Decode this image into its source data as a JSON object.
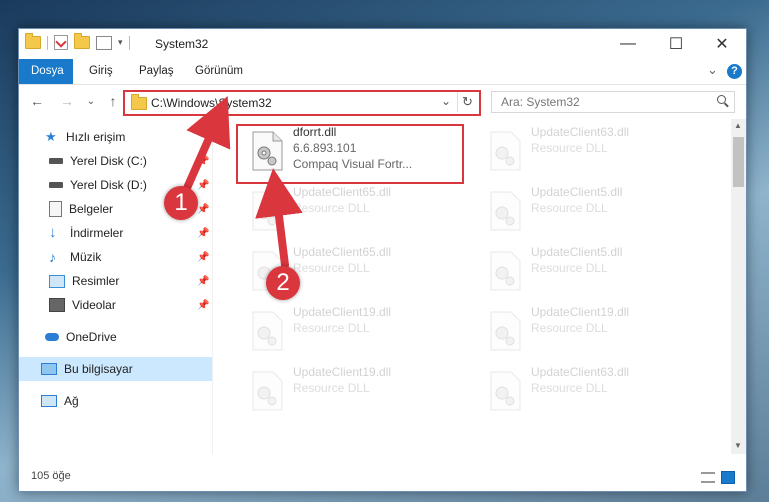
{
  "window": {
    "title": "System32",
    "controls": {
      "minimize": "—",
      "maximize": "☐",
      "close": "✕"
    }
  },
  "ribbon": {
    "tabs": [
      "Dosya",
      "Giriş",
      "Paylaş",
      "Görünüm"
    ],
    "help": "?",
    "chevron": "⌄"
  },
  "nav": {
    "back": "←",
    "forward": "→",
    "recent": "⌄",
    "up": "↑",
    "address": "C:\\Windows\\System32",
    "refresh": "↻",
    "search_placeholder": "Ara: System32"
  },
  "sidebar": {
    "items": [
      {
        "label": "Hızlı erişim",
        "icon": "star-icon",
        "pinned": false
      },
      {
        "label": "Yerel Disk (C:)",
        "icon": "disk-icon",
        "pinned": true
      },
      {
        "label": "Yerel Disk (D:)",
        "icon": "disk-icon",
        "pinned": true
      },
      {
        "label": "Belgeler",
        "icon": "documents-icon",
        "pinned": true
      },
      {
        "label": "İndirmeler",
        "icon": "download-icon",
        "pinned": true
      },
      {
        "label": "Müzik",
        "icon": "music-icon",
        "pinned": true
      },
      {
        "label": "Resimler",
        "icon": "pictures-icon",
        "pinned": true
      },
      {
        "label": "Videolar",
        "icon": "videos-icon",
        "pinned": true
      },
      {
        "label": "OneDrive",
        "icon": "cloud-icon",
        "pinned": false
      },
      {
        "label": "Bu bilgisayar",
        "icon": "computer-icon",
        "pinned": false
      },
      {
        "label": "Ağ",
        "icon": "network-icon",
        "pinned": false
      }
    ]
  },
  "files": {
    "primary": {
      "name": "dforrt.dll",
      "version": "6.6.893.101",
      "description": "Compaq Visual Fortr..."
    },
    "others": [
      {
        "name": "UpdateClient63.dll",
        "type": "Resource DLL"
      },
      {
        "name": "UpdateClient65.dll",
        "type": "Resource DLL"
      },
      {
        "name": "UpdateClient5.dll",
        "type": "Resource DLL"
      },
      {
        "name": "UpdateClient65.dll",
        "type": "Resource DLL"
      },
      {
        "name": "UpdateClient5.dll",
        "type": "Resource DLL"
      },
      {
        "name": "UpdateClient19.dll",
        "type": "Resource DLL"
      },
      {
        "name": "UpdateClient19.dll",
        "type": "Resource DLL"
      },
      {
        "name": "UpdateClient19.dll",
        "type": "Resource DLL"
      },
      {
        "name": "UpdateClient63.dll",
        "type": "Resource DLL"
      }
    ]
  },
  "status": {
    "count": "105 öğe"
  },
  "annotations": {
    "badge1": "1",
    "badge2": "2"
  },
  "colors": {
    "accent": "#1979ca",
    "highlight": "#d9363e"
  }
}
